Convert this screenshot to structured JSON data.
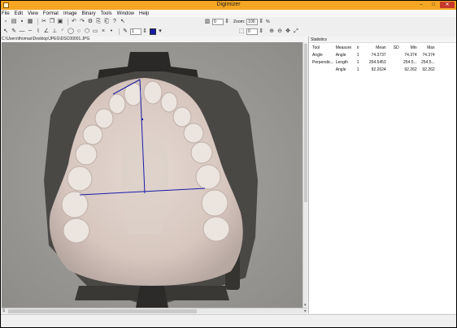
{
  "window": {
    "title": "Digimizer"
  },
  "menu": [
    "File",
    "Edit",
    "View",
    "Format",
    "Image",
    "Binary",
    "Tools",
    "Window",
    "Help"
  ],
  "toolbar": {
    "field1": "0",
    "zoom_label": "Zoom:",
    "zoom_value": "100",
    "zoom_unit": "%",
    "field2": "0",
    "line_width": "1",
    "line_color": "#1a1aa8"
  },
  "path": "C:\\Users\\thomas\\Desktop\\JPEG\\DSC00001.JPG",
  "stats": {
    "title": "Statistics",
    "columns": [
      "Tool",
      "Measure",
      "n",
      "Mean",
      "SD",
      "Min",
      "Max"
    ],
    "rows": [
      [
        "Angle",
        "Angle",
        "1",
        "74.3737",
        "",
        "74.374",
        "74.374"
      ],
      [
        "Perpendic...",
        "Length",
        "1",
        "254.5453",
        "",
        "254.5...",
        "254.5..."
      ],
      [
        "",
        "Angle",
        "1",
        "92.2624",
        "",
        "92.262",
        "92.262"
      ]
    ]
  },
  "hscroll_left": "S"
}
